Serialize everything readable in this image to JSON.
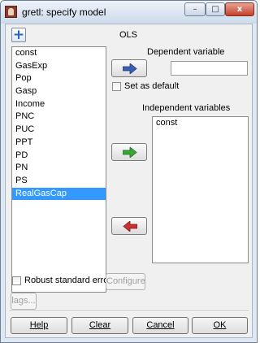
{
  "window": {
    "title": "gretl: specify model",
    "minimize": "–",
    "maximize": "□",
    "close": "x"
  },
  "model": {
    "estimator": "OLS",
    "add_button_icon": "plus-icon"
  },
  "variables": [
    "const",
    "GasExp",
    "Pop",
    "Gasp",
    "Income",
    "PNC",
    "PUC",
    "PPT",
    "PD",
    "PN",
    "PS",
    "RealGasCap"
  ],
  "selected_variable": "RealGasCap",
  "dependent": {
    "label": "Dependent variable",
    "value": "",
    "set_default_label": "Set as default",
    "set_default_checked": false
  },
  "independent": {
    "label": "Independent variables",
    "items": [
      "const"
    ]
  },
  "options": {
    "robust_label": "Robust standard errors",
    "robust_checked": false,
    "configure_label": "Configure",
    "lags_label": "lags..."
  },
  "buttons": {
    "help": "Help",
    "clear": "Clear",
    "cancel": "Cancel",
    "ok": "OK"
  },
  "colors": {
    "arrow_blue": "#3a5fb0",
    "arrow_green": "#3aa63a",
    "arrow_red": "#c83232",
    "selection": "#3399ff"
  }
}
